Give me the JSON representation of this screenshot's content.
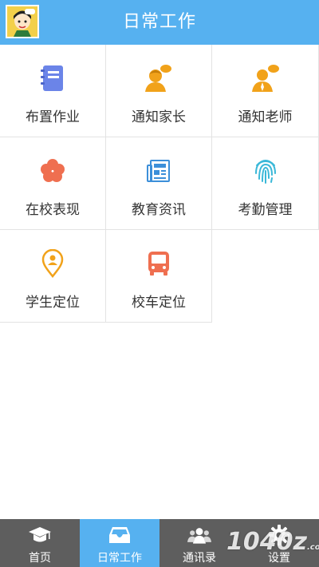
{
  "header": {
    "title": "日常工作"
  },
  "tiles": [
    {
      "label": "布置作业",
      "icon": "notebook-icon",
      "color": "#6b84e8"
    },
    {
      "label": "通知家长",
      "icon": "parent-speech-icon",
      "color": "#f1a21a"
    },
    {
      "label": "通知老师",
      "icon": "teacher-speech-icon",
      "color": "#f1a21a"
    },
    {
      "label": "在校表现",
      "icon": "flower-icon",
      "color": "#ef6f50"
    },
    {
      "label": "教育资讯",
      "icon": "newspaper-icon",
      "color": "#3c8fd9"
    },
    {
      "label": "考勤管理",
      "icon": "fingerprint-icon",
      "color": "#3ab8d8"
    },
    {
      "label": "学生定位",
      "icon": "location-pin-icon",
      "color": "#f1a21a"
    },
    {
      "label": "校车定位",
      "icon": "bus-icon",
      "color": "#ef6f50"
    }
  ],
  "tabbar": {
    "items": [
      {
        "label": "首页",
        "icon": "graduation-cap-icon"
      },
      {
        "label": "日常工作",
        "icon": "inbox-tray-icon"
      },
      {
        "label": "通讯录",
        "icon": "contacts-people-icon"
      },
      {
        "label": "设置",
        "icon": "gear-icon"
      }
    ],
    "active_index": 1
  },
  "watermark": {
    "text": "1040z",
    "suffix": ".com"
  },
  "colors": {
    "header": "#56b1f0",
    "tabbar": "#5e5e5e",
    "active_tab": "#56b1f0"
  }
}
